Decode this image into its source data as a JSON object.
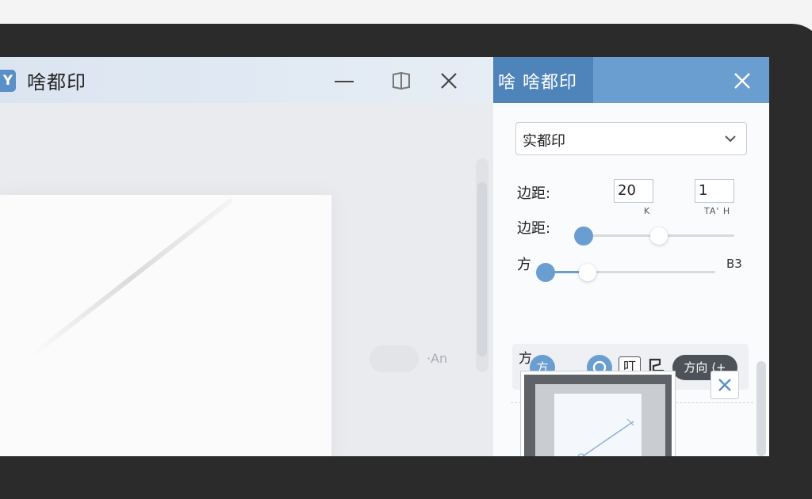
{
  "main_window": {
    "icon_glyph": "Y",
    "title": "啥都印",
    "controls": [
      "minimize-icon",
      "restore-icon",
      "close-icon"
    ],
    "ghost_text": "·An"
  },
  "panel": {
    "title": "啥 啥都印",
    "close_icon": "close-icon",
    "select": {
      "value": "实都印",
      "icon": "chevron-down-icon"
    },
    "margin_label_1": "边距:",
    "margin_value_1": "20",
    "margin_value_2": "1",
    "tiny_label_k": "K",
    "tiny_label_right": "TA' H",
    "margin_label_2": "边距:",
    "direction_label": "方",
    "direction_value": "B3",
    "toolbar": {
      "label": "方",
      "round_button": "方",
      "square_button": "叮",
      "pill_button": "方向 ⟨+"
    },
    "colors": {
      "accent": "#6a9ed0",
      "accent_dark": "#4f84bb",
      "pill": "#4d5258"
    }
  }
}
